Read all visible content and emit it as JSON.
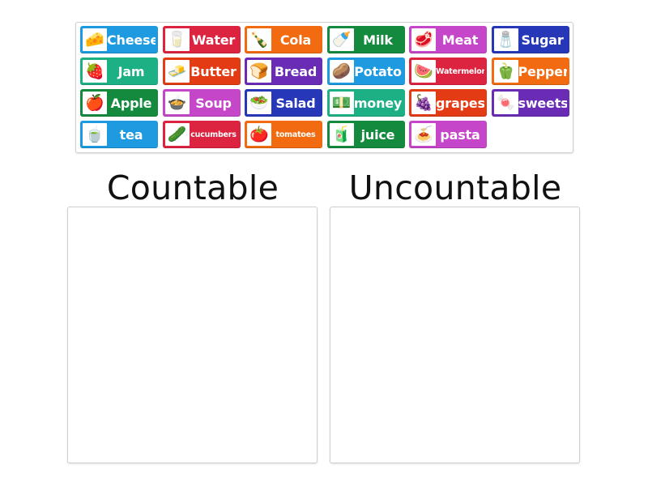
{
  "tiles": [
    {
      "label": "Cheese",
      "icon": "cheese-icon",
      "glyph": "🧀",
      "color": "#1e9be0",
      "small": false
    },
    {
      "label": "Water",
      "icon": "water-glass-icon",
      "glyph": "🥛",
      "color": "#dc2340",
      "small": false
    },
    {
      "label": "Cola",
      "icon": "cola-bottle-icon",
      "glyph": "🍾",
      "color": "#f26b10",
      "small": false
    },
    {
      "label": "Milk",
      "icon": "milk-bottle-icon",
      "glyph": "🍼",
      "color": "#148a3f",
      "small": false
    },
    {
      "label": "Meat",
      "icon": "meat-icon",
      "glyph": "🥩",
      "color": "#c546c9",
      "small": false
    },
    {
      "label": "Sugar",
      "icon": "sugar-icon",
      "glyph": "🧂",
      "color": "#2638b8",
      "small": false
    },
    {
      "label": "Jam",
      "icon": "jam-icon",
      "glyph": "🍓",
      "color": "#1db085",
      "small": false
    },
    {
      "label": "Butter",
      "icon": "butter-icon",
      "glyph": "🧈",
      "color": "#e33b14",
      "small": false
    },
    {
      "label": "Bread",
      "icon": "bread-icon",
      "glyph": "🍞",
      "color": "#6a2bb5",
      "small": false
    },
    {
      "label": "Potato",
      "icon": "potato-icon",
      "glyph": "🥔",
      "color": "#1e9be0",
      "small": false
    },
    {
      "label": "Watermelon",
      "icon": "watermelon-icon",
      "glyph": "🍉",
      "color": "#dc2340",
      "small": true
    },
    {
      "label": "Pepper",
      "icon": "pepper-icon",
      "glyph": "🫑",
      "color": "#f26b10",
      "small": false
    },
    {
      "label": "Apple",
      "icon": "apple-icon",
      "glyph": "🍎",
      "color": "#148a3f",
      "small": false
    },
    {
      "label": "Soup",
      "icon": "soup-icon",
      "glyph": "🍲",
      "color": "#c546c9",
      "small": false
    },
    {
      "label": "Salad",
      "icon": "salad-icon",
      "glyph": "🥗",
      "color": "#2638b8",
      "small": false
    },
    {
      "label": "money",
      "icon": "money-icon",
      "glyph": "💵",
      "color": "#1db085",
      "small": false
    },
    {
      "label": "grapes",
      "icon": "grapes-icon",
      "glyph": "🍇",
      "color": "#e33b14",
      "small": false
    },
    {
      "label": "sweets",
      "icon": "sweets-icon",
      "glyph": "🍬",
      "color": "#6a2bb5",
      "small": false
    },
    {
      "label": "tea",
      "icon": "tea-cup-icon",
      "glyph": "🍵",
      "color": "#1e9be0",
      "small": false
    },
    {
      "label": "cucumbers",
      "icon": "cucumber-icon",
      "glyph": "🥒",
      "color": "#dc2340",
      "small": true
    },
    {
      "label": "tomatoes",
      "icon": "tomato-icon",
      "glyph": "🍅",
      "color": "#f26b10",
      "small": true
    },
    {
      "label": "juice",
      "icon": "juice-bottle-icon",
      "glyph": "🧃",
      "color": "#148a3f",
      "small": false
    },
    {
      "label": "pasta",
      "icon": "pasta-icon",
      "glyph": "🍝",
      "color": "#c546c9",
      "small": false
    }
  ],
  "categories": [
    {
      "title": "Countable"
    },
    {
      "title": "Uncountable"
    }
  ]
}
